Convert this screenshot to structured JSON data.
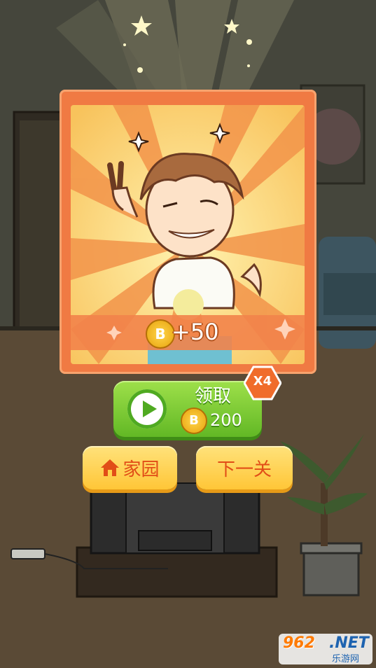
{
  "reward": {
    "coin_symbol": "B",
    "amount_text": "+50"
  },
  "claim_button": {
    "label": "领取",
    "coin_symbol": "B",
    "amount": "200",
    "multiplier": "X4"
  },
  "home_button": {
    "label": "家园"
  },
  "next_button": {
    "label": "下一关"
  },
  "watermark": {
    "main": "962",
    "suffix": ".NET",
    "sub": "乐游网"
  },
  "colors": {
    "popup_border": "#f07a43",
    "claim_green": "#62b825",
    "button_yellow": "#ffc637",
    "label_red": "#e14d17"
  }
}
